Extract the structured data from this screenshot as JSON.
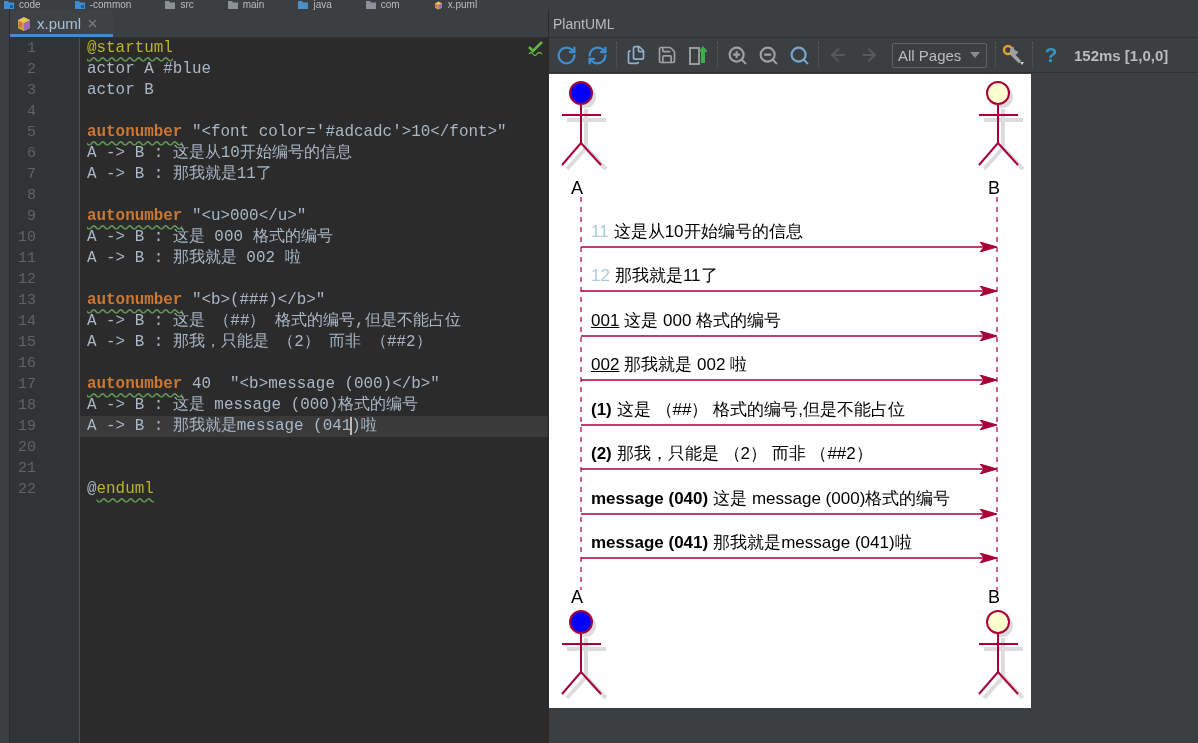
{
  "breadcrumb": [
    {
      "label": "code",
      "kind": "module"
    },
    {
      "label": "-common",
      "kind": "module"
    },
    {
      "label": "src",
      "kind": "folder"
    },
    {
      "label": "main",
      "kind": "folder"
    },
    {
      "label": "java",
      "kind": "source"
    },
    {
      "label": "com",
      "kind": "folder"
    },
    {
      "label": "x.puml",
      "kind": "file"
    }
  ],
  "editor": {
    "tabs": [
      {
        "label": "x.puml",
        "selected": true
      }
    ],
    "lines": [
      {
        "number": "1",
        "current": false,
        "tokens": [
          {
            "kind": "directive",
            "text": "@startuml"
          }
        ]
      },
      {
        "number": "2",
        "current": false,
        "tokens": [
          {
            "kind": "plain",
            "text": "actor A #blue"
          }
        ]
      },
      {
        "number": "3",
        "current": false,
        "tokens": [
          {
            "kind": "plain",
            "text": "actor B"
          }
        ]
      },
      {
        "number": "4",
        "current": false
      },
      {
        "number": "5",
        "current": false,
        "tokens": [
          {
            "kind": "keyword",
            "text": "autonumber"
          },
          {
            "kind": "plain",
            "text": " \"<font color='#adcadc'>10</font>\""
          }
        ]
      },
      {
        "number": "6",
        "current": false,
        "tokens": [
          {
            "kind": "plain",
            "text": "A -> B : 这是从10开始编号的信息"
          }
        ]
      },
      {
        "number": "7",
        "current": false,
        "tokens": [
          {
            "kind": "plain",
            "text": "A -> B : 那我就是11了"
          }
        ]
      },
      {
        "number": "8",
        "current": false
      },
      {
        "number": "9",
        "current": false,
        "tokens": [
          {
            "kind": "keyword",
            "text": "autonumber"
          },
          {
            "kind": "plain",
            "text": " \"<u>000</u>\""
          }
        ]
      },
      {
        "number": "10",
        "current": false,
        "tokens": [
          {
            "kind": "plain",
            "text": "A -> B : 这是 000 格式的编号"
          }
        ]
      },
      {
        "number": "11",
        "current": false,
        "tokens": [
          {
            "kind": "plain",
            "text": "A -> B : 那我就是 002 啦"
          }
        ]
      },
      {
        "number": "12",
        "current": false
      },
      {
        "number": "13",
        "current": false,
        "tokens": [
          {
            "kind": "keyword",
            "text": "autonumber"
          },
          {
            "kind": "plain",
            "text": " \"<b>(###)</b>\""
          }
        ]
      },
      {
        "number": "14",
        "current": false,
        "tokens": [
          {
            "kind": "plain",
            "text": "A -> B : 这是 （##） 格式的编号,但是不能占位"
          }
        ]
      },
      {
        "number": "15",
        "current": false,
        "tokens": [
          {
            "kind": "plain",
            "text": "A -> B : 那我，只能是 （2） 而非 （##2）"
          }
        ]
      },
      {
        "number": "16",
        "current": false
      },
      {
        "number": "17",
        "current": false,
        "tokens": [
          {
            "kind": "keyword",
            "text": "autonumber"
          },
          {
            "kind": "plain",
            "text": " 40  \"<b>message (000)</b>\""
          }
        ]
      },
      {
        "number": "18",
        "current": false,
        "tokens": [
          {
            "kind": "plain",
            "text": "A -> B : 这是 message (000)格式的编号"
          }
        ]
      },
      {
        "number": "19",
        "current": true,
        "tokens": [
          {
            "kind": "plain",
            "text": "A -> B : 那我就是message (041"
          },
          {
            "kind": "caret"
          },
          {
            "kind": "plain",
            "text": ")啦"
          }
        ]
      },
      {
        "number": "20",
        "current": false
      },
      {
        "number": "21",
        "current": false
      },
      {
        "number": "22",
        "current": false,
        "tokens": [
          {
            "kind": "plain",
            "text": "@"
          },
          {
            "kind": "directive",
            "text": "enduml"
          }
        ]
      }
    ]
  },
  "plantuml": {
    "title": "PlantUML",
    "toolbar": {
      "nav_buttons": [
        {
          "disabled": true
        },
        {
          "disabled": true
        }
      ],
      "page_select": {
        "value": "All Pages"
      },
      "help": "?",
      "status": "152ms [1,0,0]"
    },
    "diagram": {
      "participants": [
        {
          "top_label": "A",
          "bottom_label": "A",
          "color": "#0000ff"
        },
        {
          "top_label": "B",
          "bottom_label": "B",
          "color": "#fefece"
        }
      ],
      "messages": [
        {
          "number": "11",
          "kind": "colored",
          "color": "#adcadc",
          "text": "这是从10开始编号的信息"
        },
        {
          "number": "12",
          "kind": "colored",
          "color": "#adcadc",
          "text": "那我就是11了"
        },
        {
          "number": "001",
          "kind": "underlined",
          "text": "这是 000 格式的编号"
        },
        {
          "number": "002",
          "kind": "underlined",
          "text": "那我就是 002 啦"
        },
        {
          "number": "(1)",
          "kind": "bold",
          "text": "这是 （##） 格式的编号,但是不能占位"
        },
        {
          "number": "(2)",
          "kind": "bold",
          "text": "那我，只能是 （2） 而非 （##2）"
        },
        {
          "number": "message (040)",
          "kind": "bold",
          "text": "这是 message (000)格式的编号"
        },
        {
          "number": "message (041)",
          "kind": "bold",
          "text": "那我就是message (041)啦"
        }
      ]
    }
  }
}
